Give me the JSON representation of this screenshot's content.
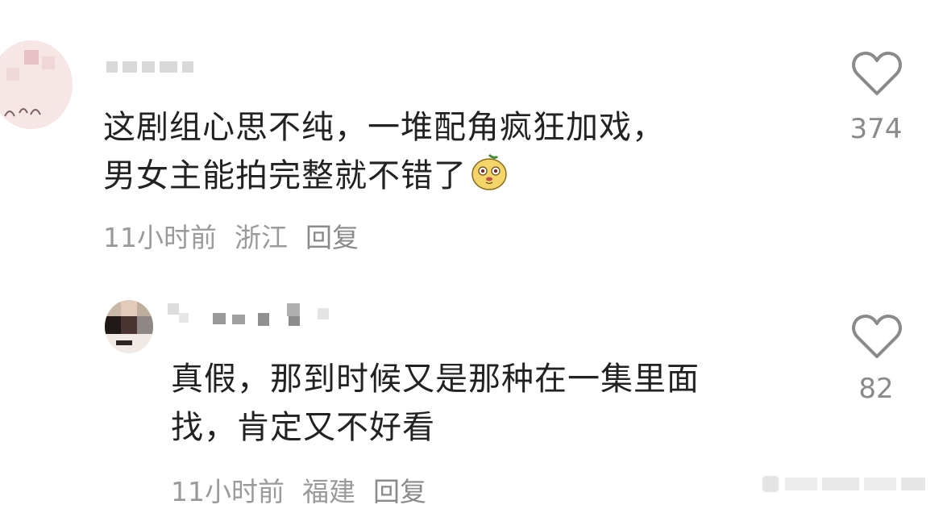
{
  "comments": [
    {
      "author": "",
      "text_lines": [
        "这剧组心思不纯，一堆配角疯狂加戏，",
        "男女主能拍完整就不错了"
      ],
      "emoji": "dog-emoji",
      "time": "11小时前",
      "location": "浙江",
      "reply_label": "回复",
      "likes": "374"
    },
    {
      "author": "",
      "text_lines": [
        "真假，那到时候又是那种在一集里面",
        "找，肯定又不好看"
      ],
      "time": "11小时前",
      "location": "福建",
      "reply_label": "回复",
      "likes": "82"
    }
  ],
  "icons": {
    "like": "heart-outline-icon"
  },
  "colors": {
    "text": "#222222",
    "meta": "#9a9a9a",
    "icon": "#8a8a8a"
  }
}
